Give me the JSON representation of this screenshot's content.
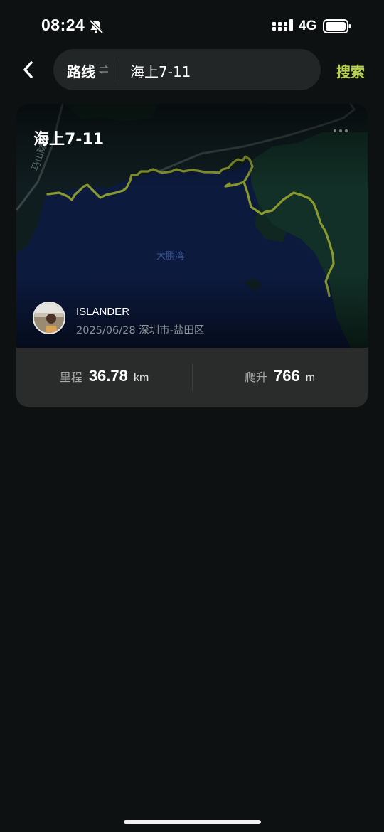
{
  "status_bar": {
    "time": "08:24",
    "network": "4G",
    "icons": [
      "bell-off-icon",
      "signal-icon",
      "battery-icon"
    ]
  },
  "header": {
    "back_icon": "chevron-left-icon",
    "route_type": "路线",
    "swap_icon": "swap-icon",
    "search_text": "海上7-11",
    "search_button": "搜索"
  },
  "card": {
    "title": "海上7-11",
    "more_icon": "more-icon",
    "map_labels": {
      "bay": "大鹏湾",
      "road": "马山隧道"
    },
    "author": "ISLANDER",
    "date": "2025/06/28",
    "location": "深圳市-盐田区",
    "stats": {
      "distance_label": "里程",
      "distance_value": "36.78",
      "distance_unit": "km",
      "climb_label": "爬升",
      "climb_value": "766",
      "climb_unit": "m"
    }
  },
  "colors": {
    "background": "#0d1111",
    "accent": "#b9d24a",
    "route_line": "#8a9a2e",
    "card": "#2a2c2c",
    "sea": "#0d1a3d"
  }
}
